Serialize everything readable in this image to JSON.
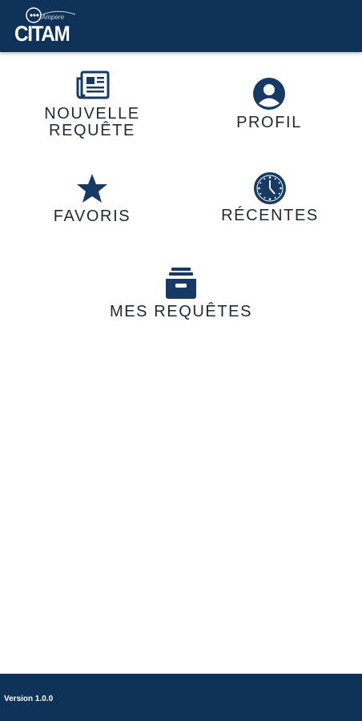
{
  "header": {
    "logo_text": "CITAM",
    "logo_subtext": "Ampere"
  },
  "menu": {
    "new_request": {
      "label_line1": "NOUVELLE",
      "label_line2": "REQUÊTE",
      "icon": "newspaper-icon"
    },
    "profile": {
      "label": "PROFIL",
      "icon": "user-circle-icon"
    },
    "favorites": {
      "label": "FAVORIS",
      "icon": "star-icon"
    },
    "recent": {
      "label": "RÉCENTES",
      "icon": "clock-icon"
    },
    "my_requests": {
      "label": "MES REQUÊTES",
      "icon": "inbox-tray-icon"
    }
  },
  "footer": {
    "version": "Version 1.0.0"
  },
  "colors": {
    "brand_navy": "#0f3358",
    "icon_navy": "#163a63",
    "text": "#222a33",
    "background": "#ffffff"
  }
}
